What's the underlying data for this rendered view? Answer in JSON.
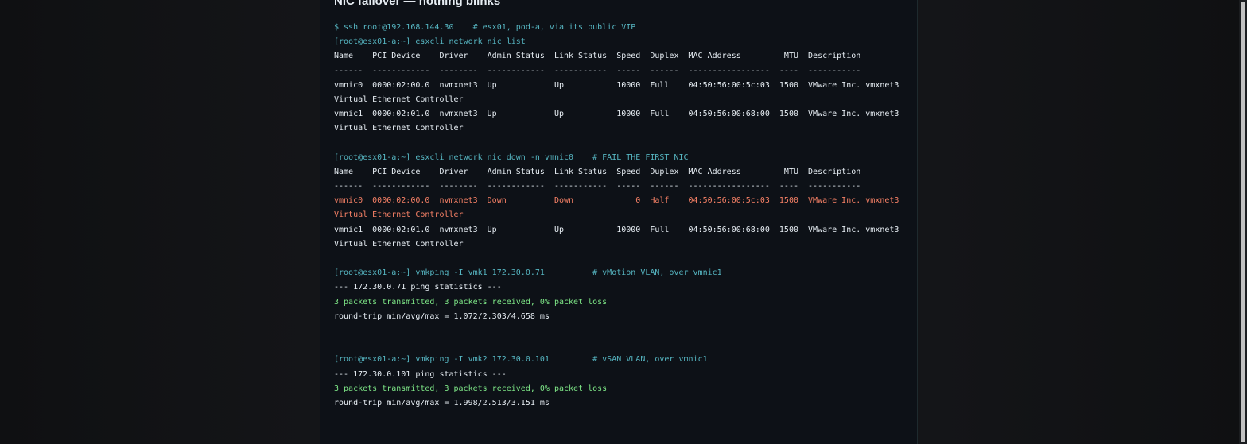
{
  "page": {
    "title": "NIC failover — nothing blinks"
  },
  "colors": {
    "background": "#0d1117",
    "prompt": "#56b6c2",
    "output": "#e6edf3",
    "success": "#7ee787",
    "error": "#f78166"
  },
  "terminal": {
    "lines": [
      {
        "text": "$ ssh root@192.168.144.30    # esx01, pod-a, via its public VIP",
        "kind": "prompt"
      },
      {
        "text": "[root@esx01-a:~] esxcli network nic list",
        "kind": "prompt"
      },
      {
        "text": "Name    PCI Device    Driver    Admin Status  Link Status  Speed  Duplex  MAC Address         MTU  Description",
        "kind": "out"
      },
      {
        "text": "------  ------------  --------  ------------  -----------  -----  ------  -----------------  ----  -----------",
        "kind": "out"
      },
      {
        "text": "vmnic0  0000:02:00.0  nvmxnet3  Up            Up           10000  Full    04:50:56:00:5c:03  1500  VMware Inc. vmxnet3",
        "kind": "out"
      },
      {
        "text": "Virtual Ethernet Controller",
        "kind": "out"
      },
      {
        "text": "vmnic1  0000:02:01.0  nvmxnet3  Up            Up           10000  Full    04:50:56:00:68:00  1500  VMware Inc. vmxnet3",
        "kind": "out"
      },
      {
        "text": "Virtual Ethernet Controller",
        "kind": "out"
      },
      {
        "text": "",
        "kind": "blank"
      },
      {
        "text": "[root@esx01-a:~] esxcli network nic down -n vmnic0    # FAIL THE FIRST NIC",
        "kind": "prompt"
      },
      {
        "text": "Name    PCI Device    Driver    Admin Status  Link Status  Speed  Duplex  MAC Address         MTU  Description",
        "kind": "out"
      },
      {
        "text": "------  ------------  --------  ------------  -----------  -----  ------  -----------------  ----  -----------",
        "kind": "out"
      },
      {
        "text": "vmnic0  0000:02:00.0  nvmxnet3  Down          Down             0  Half    04:50:56:00:5c:03  1500  VMware Inc. vmxnet3",
        "kind": "err"
      },
      {
        "text": "Virtual Ethernet Controller",
        "kind": "err"
      },
      {
        "text": "vmnic1  0000:02:01.0  nvmxnet3  Up            Up           10000  Full    04:50:56:00:68:00  1500  VMware Inc. vmxnet3",
        "kind": "out"
      },
      {
        "text": "Virtual Ethernet Controller",
        "kind": "out"
      },
      {
        "text": "",
        "kind": "blank"
      },
      {
        "text": "[root@esx01-a:~] vmkping -I vmk1 172.30.0.71          # vMotion VLAN, over vmnic1",
        "kind": "prompt"
      },
      {
        "text": "--- 172.30.0.71 ping statistics ---",
        "kind": "out"
      },
      {
        "text": "3 packets transmitted, 3 packets received, 0% packet loss",
        "kind": "ok"
      },
      {
        "text": "round-trip min/avg/max = 1.072/2.303/4.658 ms",
        "kind": "out"
      },
      {
        "text": "",
        "kind": "blank"
      },
      {
        "text": "",
        "kind": "blank"
      },
      {
        "text": "[root@esx01-a:~] vmkping -I vmk2 172.30.0.101         # vSAN VLAN, over vmnic1",
        "kind": "prompt"
      },
      {
        "text": "--- 172.30.0.101 ping statistics ---",
        "kind": "out"
      },
      {
        "text": "3 packets transmitted, 3 packets received, 0% packet loss",
        "kind": "ok"
      },
      {
        "text": "round-trip min/avg/max = 1.998/2.513/3.151 ms",
        "kind": "out"
      }
    ]
  }
}
